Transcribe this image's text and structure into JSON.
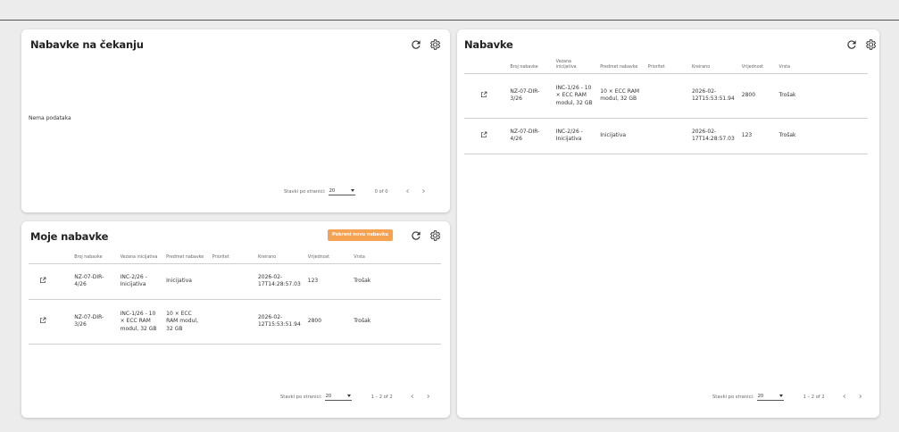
{
  "pending": {
    "title": "Nabavke na čekanju",
    "empty_text": "Nema podataka",
    "footer": {
      "per_page_label": "Stavki po stranici:",
      "per_page_value": "20",
      "range": "0 of 0"
    }
  },
  "mine": {
    "title": "Moje nabavke",
    "new_button": "Pokreni novu nabavku",
    "headers": [
      "Broj nabavke",
      "Vezana inicijativa",
      "Predmet nabavke",
      "Prioritet",
      "Kreirano",
      "Vrijednost",
      "Vrsta"
    ],
    "rows": [
      {
        "broj": "NZ-07-DIR-4/26",
        "inicijativa": "INC-2/26 - Inicijativa",
        "predmet": "Inicijativa",
        "prioritet": "",
        "kreirano": "2026-02-17T14:28:57.03",
        "vrijednost": "123",
        "vrsta": "Trošak"
      },
      {
        "broj": "NZ-07-DIR-3/26",
        "inicijativa": "INC-1/26 - 10 × ECC RAM modul, 32 GB",
        "predmet": "10 × ECC RAM modul, 32 GB",
        "prioritet": "",
        "kreirano": "2026-02-12T15:53:51.94",
        "vrijednost": "2800",
        "vrsta": "Trošak"
      }
    ],
    "footer": {
      "per_page_label": "Stavki po stranici:",
      "per_page_value": "20",
      "range": "1 – 2 of 2"
    }
  },
  "all": {
    "title": "Nabavke",
    "headers": [
      "Broj nabavke",
      "Vezana inicijativa",
      "Predmet nabavke",
      "Prioritet",
      "Kreirano",
      "Vrijednost",
      "Vrsta"
    ],
    "rows": [
      {
        "broj": "NZ-07-DIR-3/26",
        "inicijativa": "INC-1/26 - 10 × ECC RAM modul, 32 GB",
        "predmet": "10 × ECC RAM modul, 32 GB",
        "prioritet": "",
        "kreirano": "2026-02-12T15:53:51.94",
        "vrijednost": "2800",
        "vrsta": "Trošak"
      },
      {
        "broj": "NZ-07-DIR-4/26",
        "inicijativa": "INC-2/26 - Inicijativa",
        "predmet": "Inicijativa",
        "prioritet": "",
        "kreirano": "2026-02-17T14:28:57.03",
        "vrijednost": "123",
        "vrsta": "Trošak"
      }
    ],
    "footer": {
      "per_page_label": "Stavki po stranici:",
      "per_page_value": "20",
      "range": "1 – 2 of 2"
    }
  },
  "colors": {
    "accent": "#f6a253",
    "background": "#ececec"
  },
  "icons": [
    "refresh-icon",
    "settings-icon",
    "open-in-new-icon",
    "chevron-left-icon",
    "chevron-right-icon",
    "dropdown-caret-icon"
  ]
}
